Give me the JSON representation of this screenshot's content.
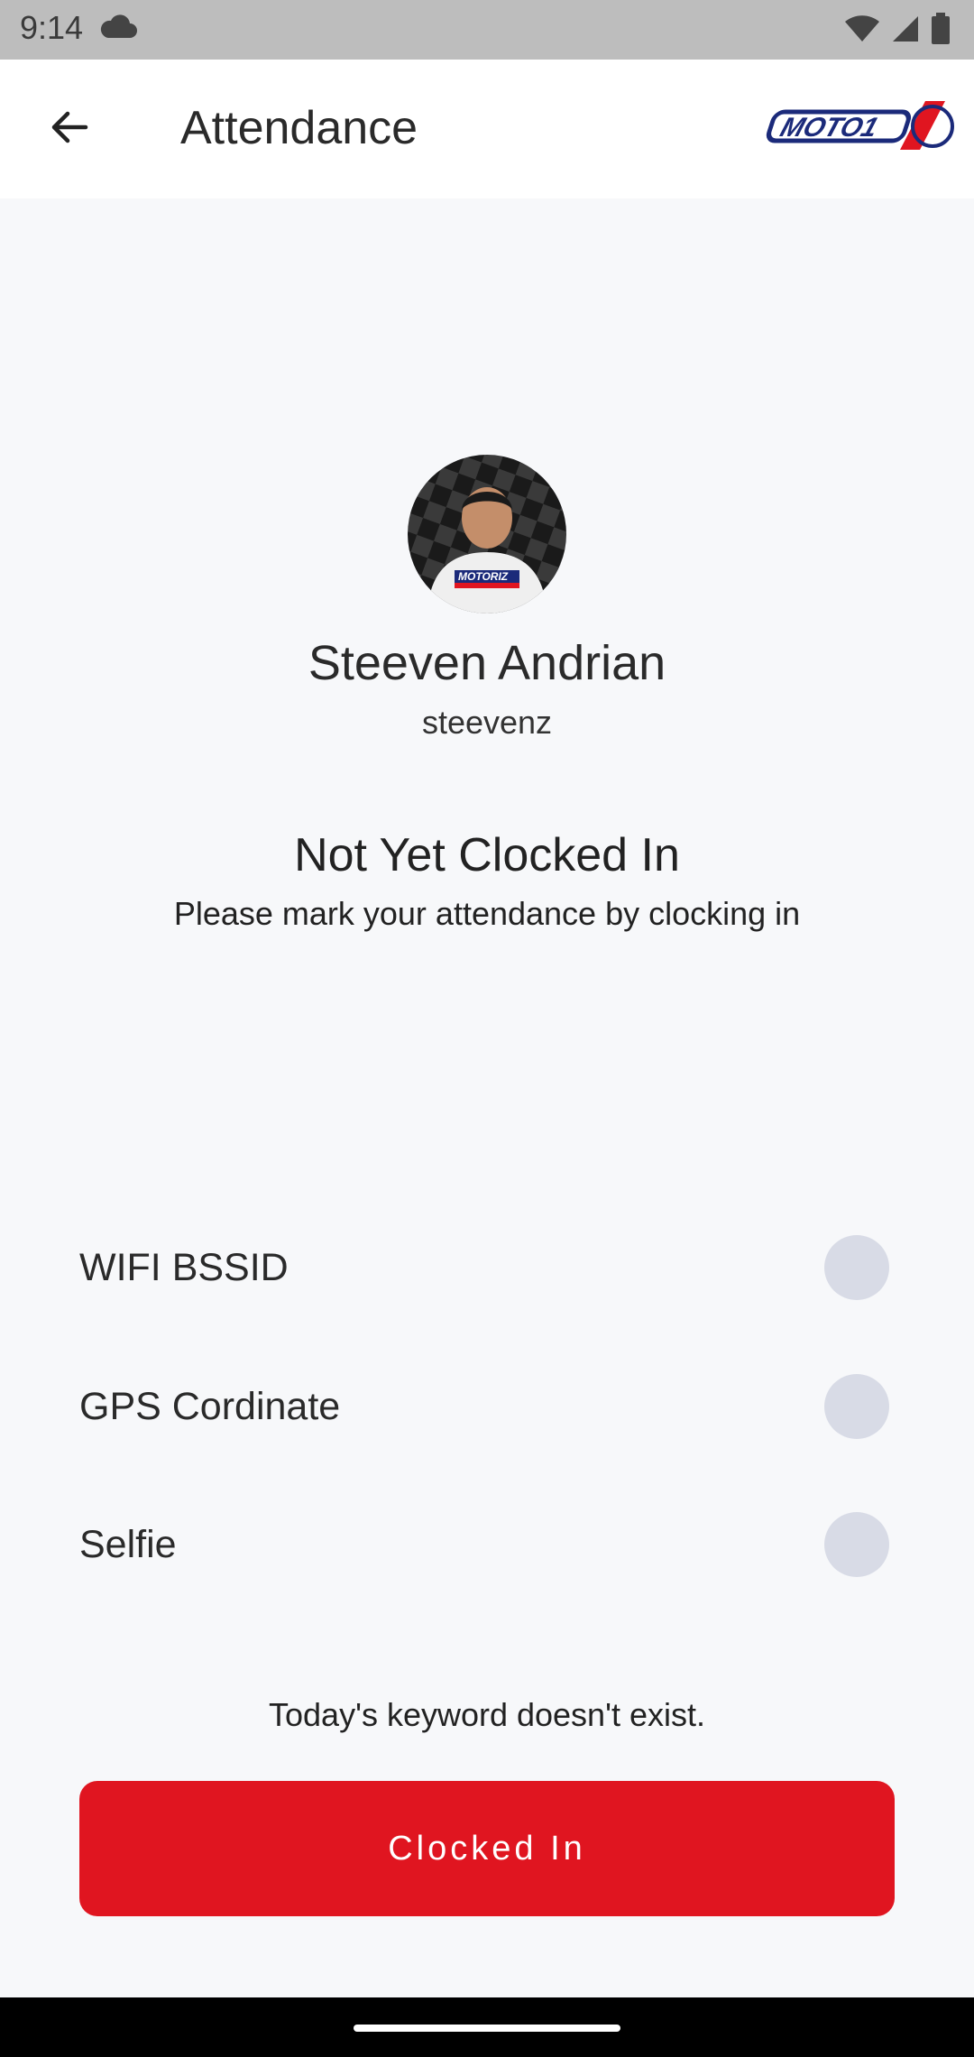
{
  "status_bar": {
    "time": "9:14",
    "icons": [
      "cloud-icon",
      "wifi-icon",
      "signal-icon",
      "battery-icon"
    ]
  },
  "app_bar": {
    "title": "Attendance",
    "back_icon": "arrow-left-icon",
    "logo_text": "MOTO1"
  },
  "profile": {
    "name": "Steeven Andrian",
    "username": "steevenz",
    "shirt_text": "MOTORIZ"
  },
  "attendance_status": {
    "heading": "Not Yet Clocked In",
    "subtext": "Please mark your attendance by clocking in"
  },
  "checks": [
    {
      "label": "WIFI BSSID"
    },
    {
      "label": "GPS Cordinate"
    },
    {
      "label": "Selfie"
    }
  ],
  "keyword_message": "Today's keyword doesn't exist.",
  "clock_in_button": {
    "label": "Clocked In"
  },
  "colors": {
    "primary": "#e01520",
    "indicator": "#d8dbe6",
    "background": "#f7f8fa"
  }
}
